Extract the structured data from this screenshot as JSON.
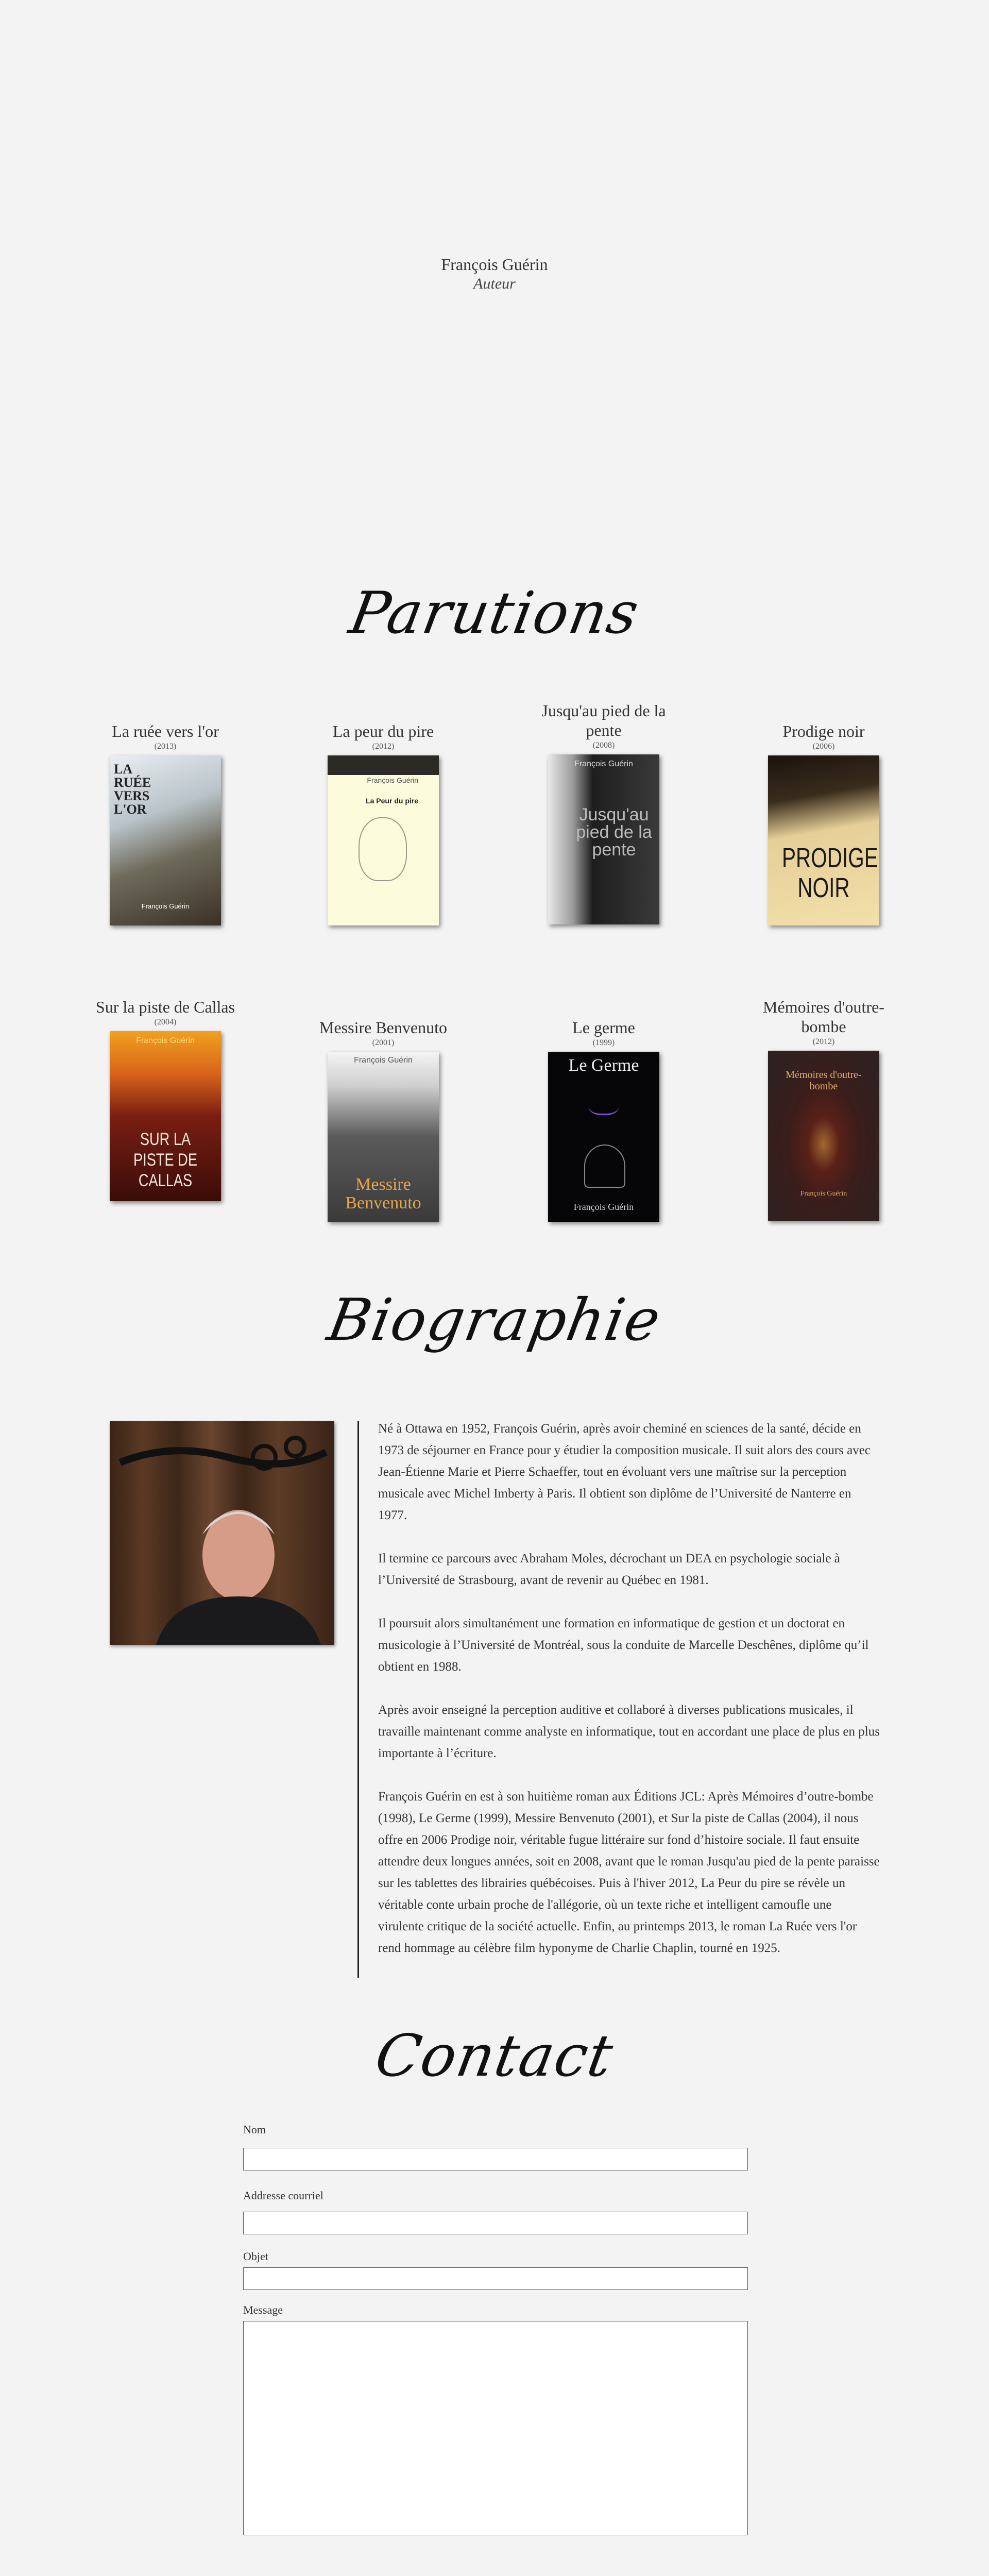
{
  "header": {
    "name": "François Guérin",
    "role": "Auteur"
  },
  "sections": {
    "parutions": "Parutions",
    "biographie": "Biographie",
    "contact": "Contact"
  },
  "books": [
    {
      "title": "La ruée vers l'or",
      "year": "(2013)",
      "cover_text": "LA RUÉE VERS L'OR"
    },
    {
      "title": "La peur du pire",
      "year": "(2012)",
      "cover_text": "La Peur du pire"
    },
    {
      "title": "Jusqu'au pied de la pente",
      "year": "(2008)",
      "cover_text": "Jusqu'au pied de la pente"
    },
    {
      "title": "Prodige noir",
      "year": "(2006)",
      "cover_text": "PRODIGE NOIR"
    },
    {
      "title": "Sur la piste de Callas",
      "year": "(2004)",
      "cover_text": "SUR LA PISTE DE CALLAS"
    },
    {
      "title": "Messire Benvenuto",
      "year": "(2001)",
      "cover_text": "Messire Benvenuto"
    },
    {
      "title": "Le germe",
      "year": "(1999)",
      "cover_text": "Le Germe"
    },
    {
      "title": "Mémoires d'outre-bombe",
      "year": "(2012)",
      "cover_text": "Mémoires d'outre-bombe"
    }
  ],
  "cover_author": "François Guérin",
  "bio_paragraphs": [
    "Né à Ottawa en 1952, François Guérin, après avoir cheminé en sciences de la santé, décide en 1973 de séjourner en France pour y étudier la composition musicale. Il suit alors des cours avec Jean-Étienne Marie et Pierre Schaeffer, tout en évoluant vers une maîtrise sur la perception musicale avec Michel Imberty à Paris. Il obtient son diplôme de l’Université de Nanterre en 1977.",
    "Il termine ce parcours avec Abraham Moles, décrochant un DEA en psychologie sociale à l’Université de Strasbourg, avant de revenir au Québec en 1981.",
    "Il poursuit alors simultanément une formation en informatique de gestion et un doctorat en musicologie à l’Université de Montréal, sous la conduite de Marcelle Deschênes, diplôme qu’il obtient en 1988.",
    "Après avoir enseigné la perception auditive et collaboré à diverses publications musicales, il travaille maintenant comme analyste en informatique, tout en accordant une place de plus en plus importante à l’écriture.",
    "François Guérin en est à son huitième roman aux Éditions JCL: Après Mémoires d’outre-bombe (1998), Le Germe (1999), Messire Benvenuto (2001), et Sur la piste de Callas (2004), il nous offre en 2006 Prodige noir, véritable fugue littéraire sur fond d’histoire sociale. Il faut ensuite attendre deux longues années, soit en 2008, avant que le roman Jusqu'au pied de la pente paraisse sur les tablettes des librairies québécoises. Puis à l'hiver 2012, La Peur du pire se révèle un véritable conte urbain proche de l'allégorie, où un texte riche et intelligent camoufle une virulente critique de la société actuelle. Enfin, au printemps 2013, le roman La Ruée vers l'or rend hommage au célèbre film hyponyme de Charlie Chaplin, tourné en 1925."
  ],
  "contact_form": {
    "name_label": "Nom",
    "email_label": "Addresse courriel",
    "subject_label": "Objet",
    "message_label": "Message"
  }
}
